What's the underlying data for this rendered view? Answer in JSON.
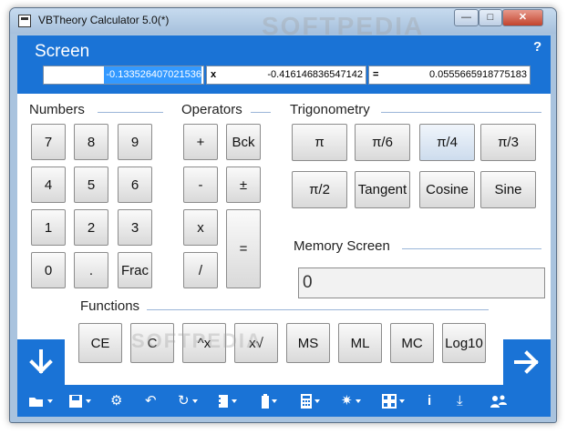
{
  "window": {
    "title": "VBTheory Calculator 5.0(*)",
    "controls": {
      "minimize": "—",
      "maximize": "□",
      "close": "✕"
    }
  },
  "screen": {
    "label": "Screen",
    "help": "?",
    "operand1": "-0.133526407021536",
    "operator": "x",
    "operand2": "-0.416146836547142",
    "equals": "=",
    "result": "0.0555665918775183"
  },
  "sections": {
    "numbers": "Numbers",
    "operators": "Operators",
    "trigonometry": "Trigonometry",
    "memory": "Memory Screen",
    "functions": "Functions"
  },
  "number_keys": [
    "7",
    "8",
    "9",
    "4",
    "5",
    "6",
    "1",
    "2",
    "3",
    "0",
    ".",
    "Frac"
  ],
  "operator_keys": {
    "plus": "+",
    "backspace": "Bck",
    "minus": "-",
    "plusminus": "±",
    "multiply": "x",
    "divide": "/",
    "equals": "="
  },
  "trig_keys": [
    "π",
    "π/6",
    "π/4",
    "π/3",
    "π/2",
    "Tangent",
    "Cosine",
    "Sine"
  ],
  "memory_value": "0",
  "function_keys": [
    "CE",
    "C",
    "^x",
    "x√",
    "MS",
    "ML",
    "MC",
    "Log10"
  ],
  "toolbar": {
    "icons": [
      "folder-open-icon",
      "save-icon",
      "gear-icon",
      "undo-icon",
      "history-icon",
      "notebook-icon",
      "battery-icon",
      "calculator-icon",
      "burst-icon",
      "grid-icon",
      "info-icon",
      "download-icon",
      "users-icon"
    ]
  },
  "watermark": "SOFTPEDIA"
}
